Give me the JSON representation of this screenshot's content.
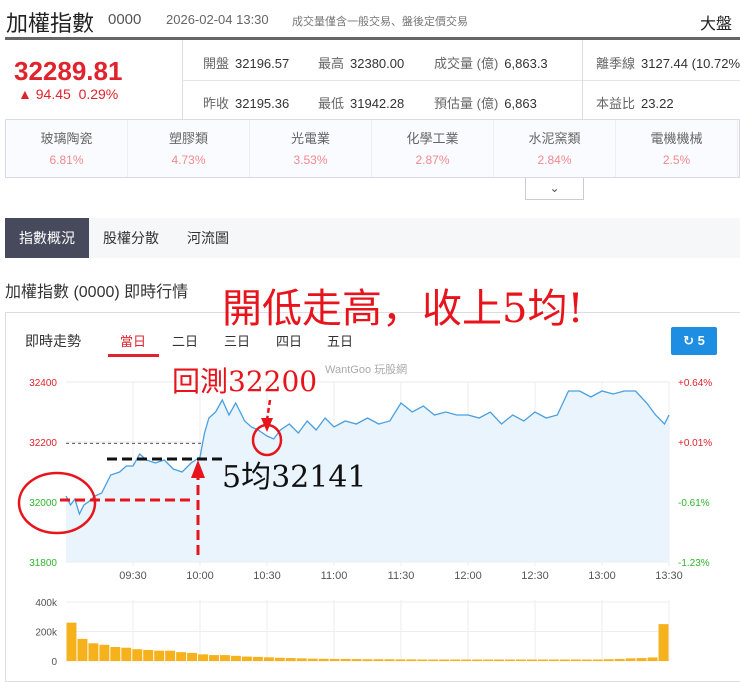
{
  "header": {
    "title": "加權指數",
    "code": "0000",
    "datetime": "2026-02-04 13:30",
    "note": "成交量僅含一般交易、盤後定價交易",
    "right_label": "大盤"
  },
  "quote": {
    "price": "32289.81",
    "change": "▲ 94.45",
    "change_pct": "0.29%",
    "items": [
      {
        "label": "開盤",
        "value": "32196.57"
      },
      {
        "label": "最高",
        "value": "32380.00"
      },
      {
        "label": "成交量 (億)",
        "value": "6,863.3"
      },
      {
        "label": "離季線",
        "value": "3127.44 (10.72%"
      },
      {
        "label": "昨收",
        "value": "32195.36"
      },
      {
        "label": "最低",
        "value": "31942.28"
      },
      {
        "label": "預估量 (億)",
        "value": "6,863"
      },
      {
        "label": "本益比",
        "value": "23.22"
      }
    ]
  },
  "sectors": [
    {
      "name": "玻璃陶瓷",
      "pct": "6.81%"
    },
    {
      "name": "塑膠類",
      "pct": "4.73%"
    },
    {
      "name": "光電業",
      "pct": "3.53%"
    },
    {
      "name": "化學工業",
      "pct": "2.87%"
    },
    {
      "name": "水泥窯類",
      "pct": "2.84%"
    },
    {
      "name": "電機機械",
      "pct": "2.5%"
    }
  ],
  "expand_icon": "chevron-down-icon",
  "tabs": [
    "指數概況",
    "股權分散",
    "河流圖"
  ],
  "section_title": "加權指數 (0000) 即時行情",
  "chart_header": {
    "label": "即時走勢",
    "ranges": [
      "當日",
      "二日",
      "三日",
      "四日",
      "五日"
    ],
    "refresh_label": "5",
    "watermark": "WantGoo 玩股網"
  },
  "annotations": {
    "main": "開低走高，收上5均!",
    "retest": "回測32200",
    "ma5": "5均32141"
  },
  "colors": {
    "up": "#e0232c",
    "down": "#2db52d",
    "line": "#4a9fe0",
    "volume": "#f5b21c",
    "annotation": "#e8141c"
  },
  "chart_data": {
    "type": "area",
    "xlabel": "",
    "ylabel": "",
    "x_ticks": [
      "09:30",
      "10:00",
      "10:30",
      "11:00",
      "11:30",
      "12:00",
      "12:30",
      "13:00",
      "13:30"
    ],
    "y_ticks": [
      "32400",
      "32200",
      "32000",
      "31800"
    ],
    "y_right_ticks": [
      "+0.64%",
      "+0.01%",
      "-0.61%",
      "-1.23%"
    ],
    "ylim": [
      31800,
      32400
    ],
    "reference_price": 32195.36,
    "ma5": 32141,
    "series": [
      {
        "name": "加權指數",
        "minutes": [
          0,
          2,
          4,
          6,
          8,
          10,
          13,
          16,
          20,
          24,
          27,
          30,
          33,
          36,
          40,
          44,
          48,
          52,
          56,
          60,
          62,
          64,
          67,
          70,
          73,
          76,
          80,
          83,
          86,
          90,
          93,
          96,
          100,
          104,
          108,
          112,
          116,
          120,
          125,
          130,
          135,
          140,
          145,
          150,
          155,
          160,
          165,
          170,
          175,
          180,
          185,
          190,
          195,
          200,
          205,
          210,
          215,
          220,
          225,
          230,
          235,
          240,
          245,
          250,
          255,
          260,
          264,
          268,
          270
        ],
        "values": [
          32020,
          31990,
          32010,
          31960,
          31990,
          32000,
          32020,
          32030,
          32090,
          32100,
          32120,
          32120,
          32160,
          32140,
          32130,
          32140,
          32110,
          32100,
          32130,
          32150,
          32230,
          32280,
          32300,
          32340,
          32290,
          32330,
          32270,
          32250,
          32240,
          32220,
          32210,
          32240,
          32260,
          32230,
          32270,
          32240,
          32280,
          32250,
          32270,
          32260,
          32280,
          32260,
          32270,
          32330,
          32300,
          32320,
          32290,
          32300,
          32290,
          32290,
          32280,
          32300,
          32260,
          32290,
          32270,
          32300,
          32280,
          32290,
          32370,
          32370,
          32350,
          32370,
          32360,
          32370,
          32370,
          32330,
          32290,
          32260,
          32290
        ]
      },
      {
        "name": "volume_k",
        "interval_minutes": 5,
        "values": [
          260,
          150,
          120,
          110,
          95,
          90,
          80,
          75,
          70,
          70,
          60,
          55,
          45,
          40,
          40,
          35,
          30,
          28,
          25,
          22,
          20,
          18,
          16,
          15,
          14,
          14,
          13,
          12,
          12,
          12,
          11,
          11,
          10,
          10,
          10,
          10,
          10,
          10,
          10,
          10,
          10,
          10,
          10,
          10,
          10,
          10,
          10,
          10,
          10,
          12,
          14,
          18,
          20,
          24,
          250
        ]
      }
    ],
    "volume_ylim": [
      0,
      400
    ],
    "volume_ticks": [
      "400k",
      "200k",
      "0"
    ]
  }
}
